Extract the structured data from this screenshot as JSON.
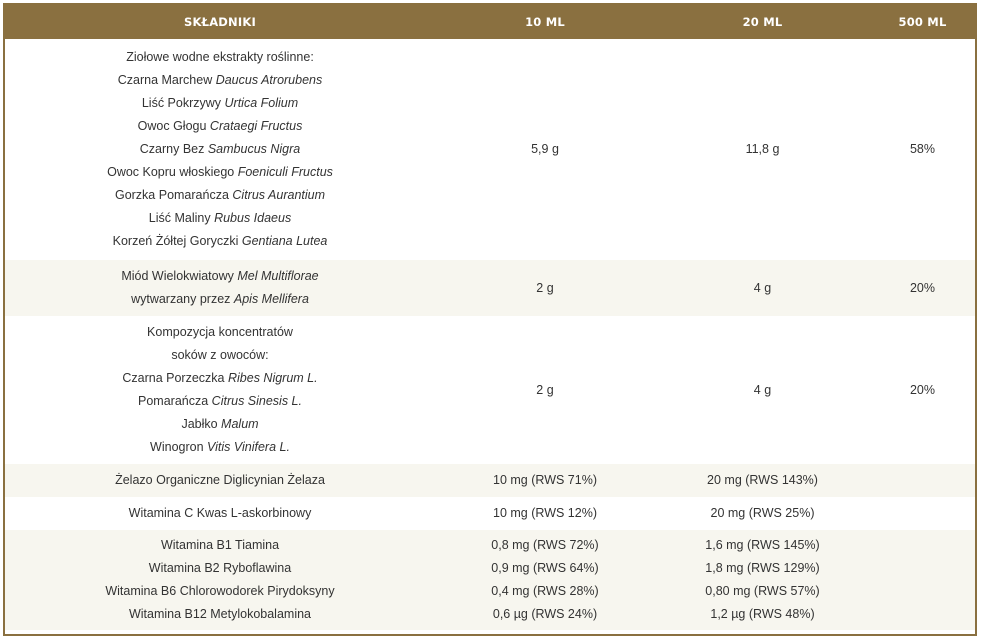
{
  "header": [
    "SKŁADNIKI",
    "10 ML",
    "20 ML",
    "500 ML"
  ],
  "rows": [
    {
      "ingredient": [
        {
          "text": "Ziołowe wodne ekstrakty roślinne:",
          "latin": ""
        },
        {
          "text": "Czarna Marchew ",
          "latin": "Daucus Atrorubens"
        },
        {
          "text": "Liść Pokrzywy ",
          "latin": "Urtica Folium"
        },
        {
          "text": "Owoc Głogu ",
          "latin": "Crataegi Fructus"
        },
        {
          "text": "Czarny Bez ",
          "latin": "Sambucus Nigra"
        },
        {
          "text": "Owoc Kopru włoskiego ",
          "latin": "Foeniculi Fructus"
        },
        {
          "text": "Gorzka Pomarańcza ",
          "latin": "Citrus Aurantium"
        },
        {
          "text": "Liść Maliny ",
          "latin": "Rubus Idaeus"
        },
        {
          "text": "Korzeń Żółtej Goryczki ",
          "latin": "Gentiana Lutea"
        }
      ],
      "ml10": [
        "5,9 g"
      ],
      "ml20": [
        "11,8 g"
      ],
      "ml500": [
        "58%"
      ]
    },
    {
      "ingredient": [
        {
          "text": "Miód Wielokwiatowy ",
          "latin": "Mel Multiflorae"
        },
        {
          "text": "wytwarzany przez ",
          "latin": "Apis Mellifera"
        }
      ],
      "ml10": [
        "2 g"
      ],
      "ml20": [
        "4 g"
      ],
      "ml500": [
        "20%"
      ]
    },
    {
      "ingredient": [
        {
          "text": "Kompozycja koncentratów",
          "latin": ""
        },
        {
          "text": "soków z owoców:",
          "latin": ""
        },
        {
          "text": "Czarna Porzeczka ",
          "latin": "Ribes Nigrum L."
        },
        {
          "text": "Pomarańcza ",
          "latin": "Citrus Sinesis L."
        },
        {
          "text": "Jabłko ",
          "latin": "Malum"
        },
        {
          "text": "Winogron ",
          "latin": "Vitis Vinifera L."
        }
      ],
      "ml10": [
        "2 g"
      ],
      "ml20": [
        "4 g"
      ],
      "ml500": [
        "20%"
      ]
    },
    {
      "ingredient": [
        {
          "text": "Żelazo Organiczne Diglicynian Żelaza",
          "latin": ""
        }
      ],
      "ml10": [
        "10 mg (RWS 71%)"
      ],
      "ml20": [
        "20 mg (RWS 143%)"
      ],
      "ml500": [
        ""
      ]
    },
    {
      "ingredient": [
        {
          "text": "Witamina C Kwas L-askorbinowy",
          "latin": ""
        }
      ],
      "ml10": [
        "10 mg (RWS 12%)"
      ],
      "ml20": [
        "20 mg (RWS 25%)"
      ],
      "ml500": [
        ""
      ]
    },
    {
      "ingredient": [
        {
          "text": "Witamina B1 Tiamina",
          "latin": ""
        },
        {
          "text": "Witamina B2 Ryboflawina",
          "latin": ""
        },
        {
          "text": "Witamina B6 Chlorowodorek Pirydoksyny",
          "latin": ""
        },
        {
          "text": "Witamina B12 Metylokobalamina",
          "latin": ""
        }
      ],
      "ml10": [
        "0,8 mg (RWS 72%)",
        "0,9 mg (RWS 64%)",
        "0,4 mg (RWS 28%)",
        "0,6 µg (RWS 24%)"
      ],
      "ml20": [
        "1,6 mg (RWS 145%)",
        "1,8 mg (RWS 129%)",
        "0,80 mg (RWS 57%)",
        "1,2 µg (RWS 48%)"
      ],
      "ml500": [
        ""
      ]
    }
  ]
}
